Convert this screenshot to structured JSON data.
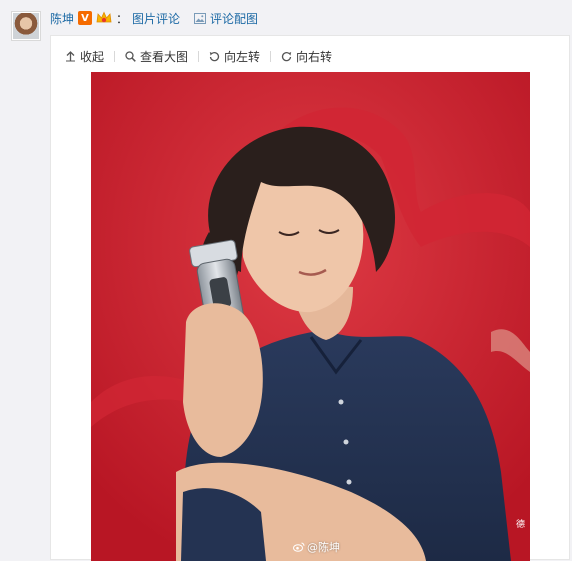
{
  "post": {
    "author": "陈坤",
    "colon": "：",
    "label": "图片评论",
    "pic_comment": "评论配图"
  },
  "toolbar": {
    "collapse": "收起",
    "view_large": "查看大图",
    "rotate_left": "向左转",
    "rotate_right": "向右转"
  },
  "image": {
    "watermark": "@陈坤",
    "edge_text": "德"
  },
  "colors": {
    "link": "#1d6aa5",
    "verified_badge": "#f56b00",
    "photo_background": "#c8202e"
  }
}
